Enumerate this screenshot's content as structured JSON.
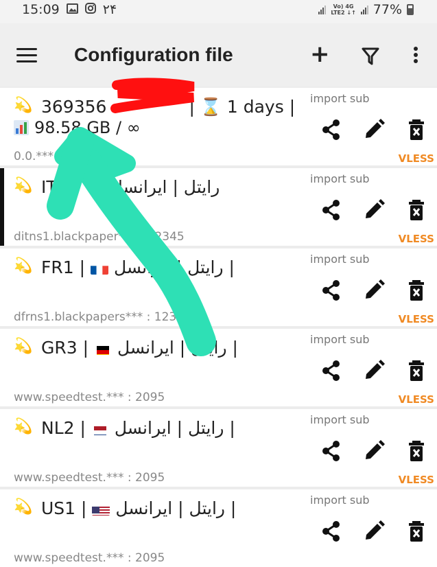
{
  "status_bar": {
    "time": "15:09",
    "left_extra": "۲۴",
    "battery": "77%",
    "net_top": "Vo) 4G",
    "net_bottom": "LTE2 ↓↑"
  },
  "app_bar": {
    "title": "Configuration file",
    "icons": [
      "menu-icon",
      "add-icon",
      "filter-icon",
      "more-vert-icon"
    ]
  },
  "colors": {
    "accent": "#f08a24",
    "annotation_arrow": "#2ee0b5",
    "annotation_scribble": "#ff1010"
  },
  "configs": [
    {
      "emoji": "💫",
      "name": "369356",
      "name_suffix": "| ⌛ 1 days |",
      "usage": "98.58 GB / ∞",
      "address": "0.0.*** :",
      "sub": "import sub",
      "protocol": "VLESS"
    },
    {
      "emoji": "💫",
      "name": "IT",
      "name_suffix": "رایتل | ایرانسل",
      "address": "ditns1.blackpaper*** : 12345",
      "sub": "import sub",
      "protocol": "VLESS"
    },
    {
      "emoji": "💫",
      "name": "FR1 |",
      "flag": "fr",
      "name_suffix": "| رایتل | ایرانسل",
      "address": "dfrns1.blackpapers*** : 12345",
      "sub": "import sub",
      "protocol": "VLESS"
    },
    {
      "emoji": "💫",
      "name": "GR3 |",
      "flag": "de",
      "name_suffix": "| رایتل | ایرانسل",
      "address": "www.speedtest.*** : 2095",
      "sub": "import sub",
      "protocol": "VLESS"
    },
    {
      "emoji": "💫",
      "name": "NL2 |",
      "flag": "nl",
      "name_suffix": "| رایتل | ایرانسل",
      "address": "www.speedtest.*** : 2095",
      "sub": "import sub",
      "protocol": "VLESS"
    },
    {
      "emoji": "💫",
      "name": "US1 |",
      "flag": "us",
      "name_suffix": "| رایتل | ایرانسل",
      "address": "www.speedtest.*** : 2095",
      "sub": "import sub",
      "protocol": "VLESS"
    }
  ]
}
